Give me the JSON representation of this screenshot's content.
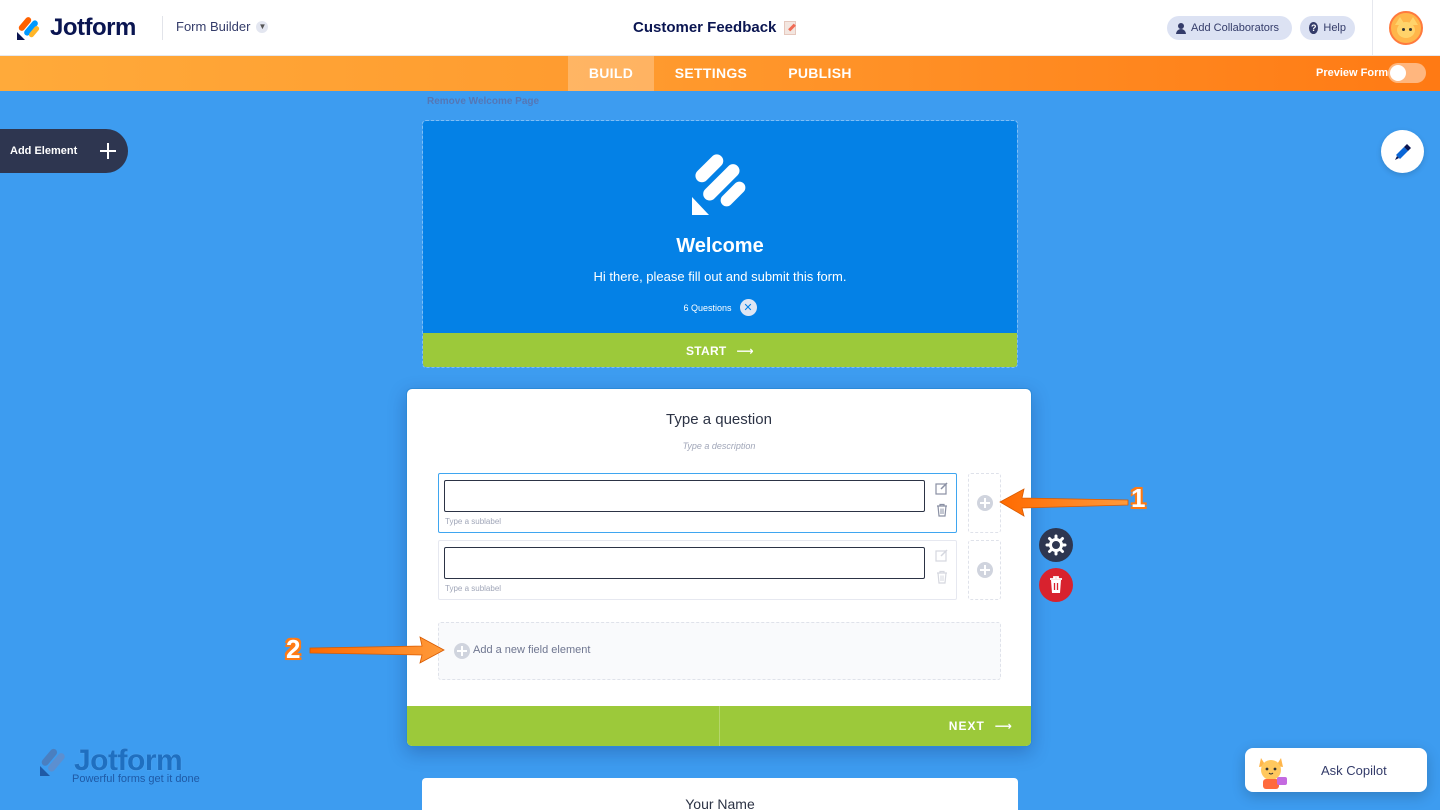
{
  "header": {
    "logo_text": "Jotform",
    "menu_label": "Form Builder",
    "form_title": "Customer Feedback",
    "collaborators_label": "Add Collaborators",
    "help_label": "Help"
  },
  "nav": {
    "tabs": [
      "BUILD",
      "SETTINGS",
      "PUBLISH"
    ],
    "active_tab": "BUILD",
    "preview_label": "Preview Form"
  },
  "sidebar": {
    "add_element_label": "Add Element"
  },
  "welcome": {
    "remove_label": "Remove Welcome Page",
    "title": "Welcome",
    "subtitle": "Hi there, please fill out and submit this form.",
    "question_count": "6 Questions",
    "start_label": "START"
  },
  "question": {
    "title": "Type a question",
    "description": "Type a description",
    "fields": [
      {
        "sublabel": "Type a sublabel"
      },
      {
        "sublabel": "Type a sublabel"
      }
    ],
    "add_field_label": "Add a new field element",
    "next_label": "NEXT"
  },
  "annotations": {
    "label_1": "1",
    "label_2": "2"
  },
  "next_card": {
    "title": "Your Name"
  },
  "watermark": {
    "title": "Jotform",
    "tagline": "Powerful forms get it done"
  },
  "copilot": {
    "label": "Ask Copilot"
  },
  "colors": {
    "background": "#3d9cf0",
    "accent_orange": "#ff7a14",
    "green": "#9cc93a",
    "welcome_blue": "#0481e6",
    "navy": "#0a1551",
    "danger": "#d8222e"
  }
}
